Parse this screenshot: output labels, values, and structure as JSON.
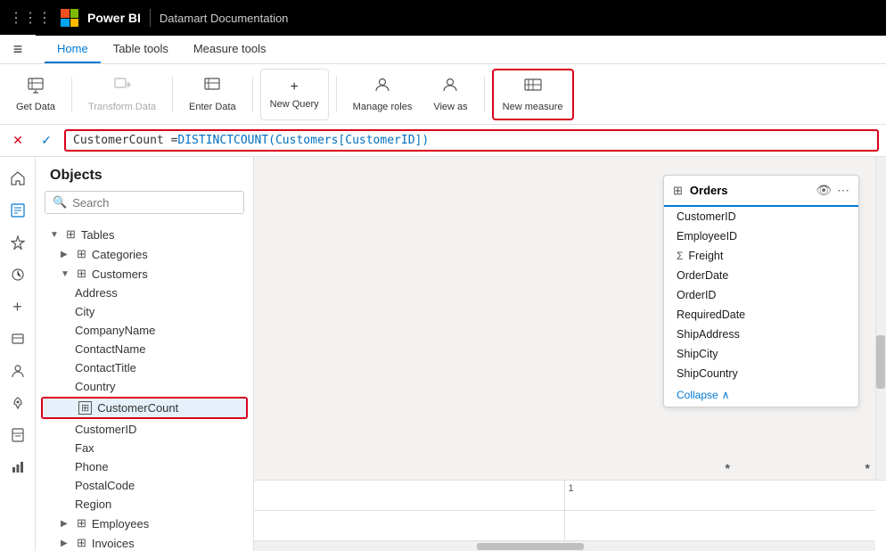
{
  "topbar": {
    "title": "Power BI",
    "subtitle": "Datamart Documentation"
  },
  "tabs": {
    "items": [
      {
        "label": "Home",
        "active": true
      },
      {
        "label": "Table tools",
        "active": false
      },
      {
        "label": "Measure tools",
        "active": false
      }
    ]
  },
  "toolbar": {
    "get_data": "Get Data",
    "transform_data": "Transform Data",
    "enter_data": "Enter Data",
    "new_query": "New Query",
    "manage_roles": "Manage roles",
    "view_as": "View as",
    "new_measure": "New measure"
  },
  "formula": {
    "text": "CustomerCount = DISTINCTCOUNT(Customers[CustomerID])",
    "text_plain": "CustomerCount = ",
    "text_func": "DISTINCTCOUNT",
    "text_arg": "(Customers[CustomerID])"
  },
  "objects": {
    "title": "Objects",
    "search_placeholder": "Search"
  },
  "tree": {
    "tables_label": "Tables",
    "categories": "Categories",
    "customers": "Customers",
    "fields": [
      "Address",
      "City",
      "CompanyName",
      "ContactName",
      "ContactTitle",
      "Country",
      "CustomerCount",
      "CustomerID",
      "Fax",
      "Phone",
      "PostalCode",
      "Region"
    ],
    "employees": "Employees",
    "invoices": "Invoices"
  },
  "orders_card": {
    "title": "Orders",
    "fields": [
      {
        "name": "CustomerID",
        "sigma": false
      },
      {
        "name": "EmployeeID",
        "sigma": false
      },
      {
        "name": "Freight",
        "sigma": true
      },
      {
        "name": "OrderDate",
        "sigma": false
      },
      {
        "name": "OrderID",
        "sigma": false
      },
      {
        "name": "RequiredDate",
        "sigma": false
      },
      {
        "name": "ShipAddress",
        "sigma": false
      },
      {
        "name": "ShipCity",
        "sigma": false
      },
      {
        "name": "ShipCountry",
        "sigma": false
      }
    ],
    "collapse": "Collapse"
  },
  "icons": {
    "hamburger": "≡",
    "home": "⌂",
    "star": "☆",
    "clock": "◷",
    "plus": "+",
    "layers": "⧉",
    "people": "👤",
    "rocket": "🚀",
    "bookmark": "◫",
    "bar_chart": "▦",
    "search": "🔍",
    "table_icon": "⊞",
    "close": "✕",
    "check": "✓",
    "expand": "▶",
    "expanded": "▼",
    "chevron_up": "∧",
    "preview": "👁",
    "more": "⋯",
    "sigma": "Σ",
    "measure": "📐",
    "grid_icon": "⊞"
  },
  "grid": {
    "star1": "*",
    "star2": "*",
    "number1": "1"
  }
}
